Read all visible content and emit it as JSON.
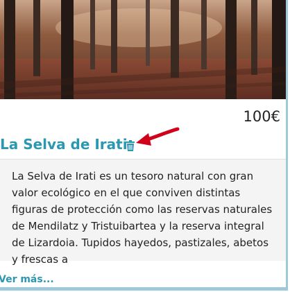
{
  "card": {
    "image_alt": "La Selva de Irati",
    "price": "100€",
    "title": "La Selva de Irati",
    "description": "La Selva de Irati es un tesoro natural con gran valor ecológico en el que conviven distintas figuras de protección como las reservas naturales de Mendilatz y Tristuibartea y la reserva integral de Lizardoia. Tupidos hayedos, pastizales, abetos y frescas a",
    "more_link": "Ver más...",
    "delete_icon": "trash-icon",
    "accent_color": "#2b97b0",
    "annotation_color": "#d0021b"
  }
}
